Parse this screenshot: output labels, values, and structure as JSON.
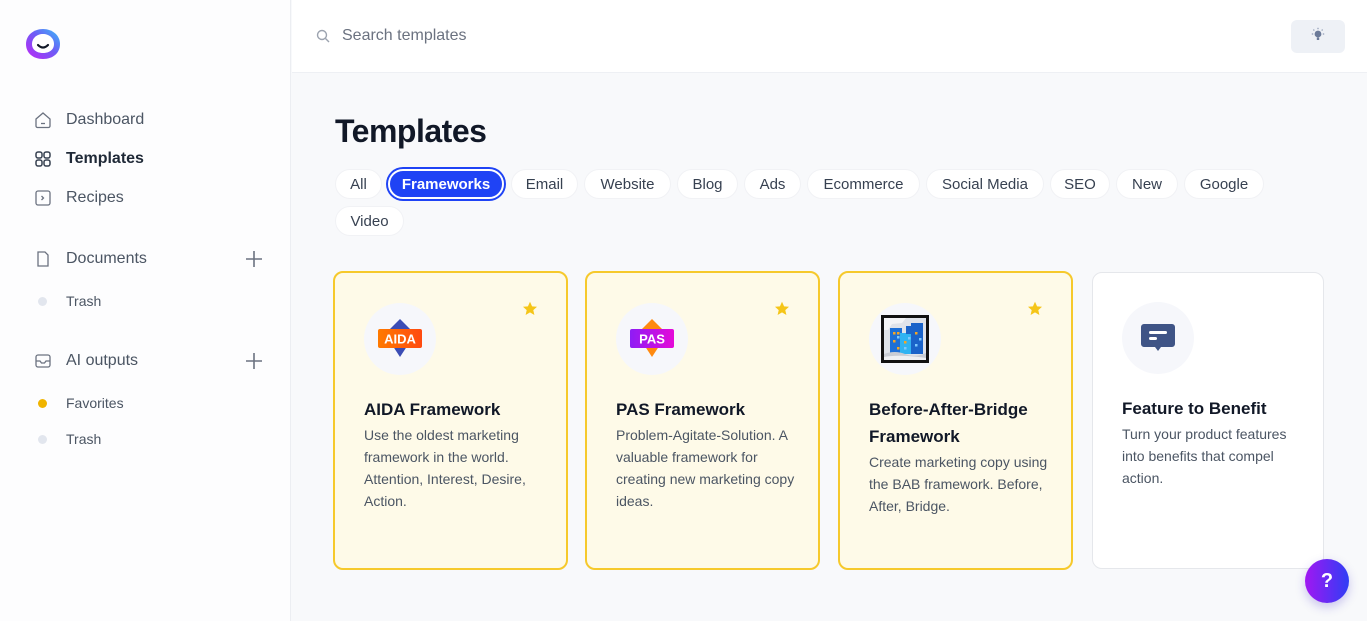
{
  "app": {
    "logo_icon": "jasper-face-logo"
  },
  "sidebar": {
    "nav": [
      {
        "label": "Dashboard",
        "icon": "home-icon",
        "active": false
      },
      {
        "label": "Templates",
        "icon": "grid-icon",
        "active": true
      },
      {
        "label": "Recipes",
        "icon": "terminal-icon",
        "active": false
      }
    ],
    "documents": {
      "label": "Documents",
      "icon": "document-icon",
      "add_icon": "plus-icon",
      "items": [
        {
          "label": "Trash",
          "dot_color": "#e2e6ee"
        }
      ]
    },
    "ai_outputs": {
      "label": "AI outputs",
      "icon": "inbox-icon",
      "add_icon": "plus-icon",
      "items": [
        {
          "label": "Favorites",
          "dot_color": "#f0b400"
        },
        {
          "label": "Trash",
          "dot_color": "#e2e6ee"
        }
      ]
    }
  },
  "header": {
    "search": {
      "placeholder": "Search templates",
      "value": ""
    },
    "theme_toggle_icon": "lightbulb-icon"
  },
  "main": {
    "title": "Templates",
    "filters": [
      {
        "label": "All",
        "active": false
      },
      {
        "label": "Frameworks",
        "active": true
      },
      {
        "label": "Email",
        "active": false
      },
      {
        "label": "Website",
        "active": false
      },
      {
        "label": "Blog",
        "active": false
      },
      {
        "label": "Ads",
        "active": false
      },
      {
        "label": "Ecommerce",
        "active": false
      },
      {
        "label": "Social Media",
        "active": false
      },
      {
        "label": "SEO",
        "active": false
      },
      {
        "label": "New",
        "active": false
      },
      {
        "label": "Google",
        "active": false
      },
      {
        "label": "Video",
        "active": false
      }
    ],
    "cards": [
      {
        "title": "AIDA Framework",
        "description": "Use the oldest marketing framework in the world. Attention, Interest, Desire, Action.",
        "icon": "aida-badge-icon",
        "icon_text": "AIDA",
        "favorite": true
      },
      {
        "title": "PAS Framework",
        "description": "Problem-Agitate-Solution. A valuable framework for creating new marketing copy ideas.",
        "icon": "pas-badge-icon",
        "icon_text": "PAS",
        "favorite": true
      },
      {
        "title": "Before-After-Bridge Framework",
        "description": "Create marketing copy using the BAB framework. Before, After, Bridge.",
        "icon": "city-picture-icon",
        "favorite": true
      },
      {
        "title": "Feature to Benefit",
        "description": "Turn your product features into benefits that compel action.",
        "icon": "chat-bubble-icon",
        "favorite": false
      }
    ]
  },
  "help": {
    "label": "?"
  },
  "colors": {
    "accent": "#1f43f5",
    "favorite_border": "#f6c92c",
    "favorite_bg": "#fefae8",
    "star": "#f5c518",
    "help_gradient_start": "#a117f2",
    "help_gradient_end": "#2f3ef5"
  }
}
